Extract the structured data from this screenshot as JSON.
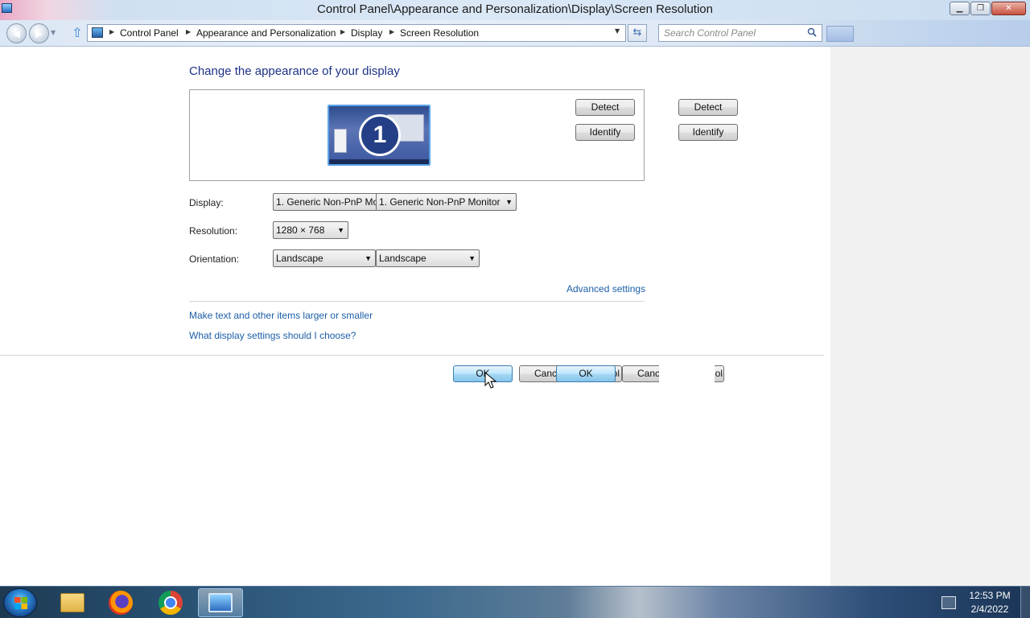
{
  "window": {
    "title": "Control Panel\\Appearance and Personalization\\Display\\Screen Resolution",
    "minimize_glyph": "▁",
    "maximize_glyph": "❐",
    "close_glyph": "✕"
  },
  "addressbar": {
    "breadcrumbs": [
      "Control Panel",
      "Appearance and Personalization",
      "Display",
      "Screen Resolution"
    ],
    "search_placeholder": "Search Control Panel",
    "icons": [
      "back-arrow-icon",
      "forward-arrow-icon",
      "up-arrow-icon",
      "control-panel-icon",
      "refresh-icon",
      "search-icon"
    ]
  },
  "main": {
    "title": "Change the appearance of your display",
    "monitor_number": "1",
    "detect_label": "Detect",
    "identify_label": "Identify",
    "display_label": "Display:",
    "display_value_clipped": "1. Generic Non-PnP Mo",
    "display_value": "1. Generic Non-PnP Monitor",
    "resolution_label": "Resolution:",
    "resolution_value": "1280 × 768",
    "orientation_label": "Orientation:",
    "orientation_value": "Landscape",
    "advanced_link": "Advanced settings",
    "link_text_size": "Make text and other items larger or smaller",
    "link_help": "What display settings should I choose?",
    "ok_label": "OK",
    "cancel_label_clipped": "Canc",
    "apply_fragment": "pl",
    "apply_fragment_right": "ol"
  },
  "taskbar": {
    "time": "12:53 PM",
    "date": "2/4/2022",
    "pinned": [
      "windows-explorer",
      "firefox",
      "chrome",
      "screen-resolution"
    ]
  },
  "colors": {
    "link": "#1c5fa8",
    "title": "#1e3287",
    "ok_button": "#85c4ea",
    "side_pane": "#f1f1f1"
  }
}
